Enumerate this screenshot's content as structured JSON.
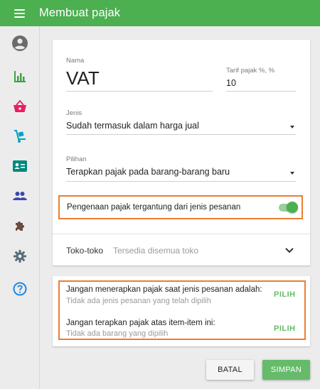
{
  "header": {
    "title": "Membuat pajak",
    "menu_icon": "hamburger-menu-icon"
  },
  "sidebar": {
    "items": [
      {
        "name": "profile",
        "icon": "account-circle-icon",
        "color": "#6b6b6b"
      },
      {
        "name": "reports",
        "icon": "bar-chart-icon",
        "color": "#43a047"
      },
      {
        "name": "items",
        "icon": "shopping-basket-icon",
        "color": "#e91e63"
      },
      {
        "name": "inventory",
        "icon": "dolly-cart-icon",
        "color": "#00a1c9"
      },
      {
        "name": "employees",
        "icon": "id-card-icon",
        "color": "#00897b"
      },
      {
        "name": "customers",
        "icon": "people-icon",
        "color": "#3949ab"
      },
      {
        "name": "integrations",
        "icon": "puzzle-icon",
        "color": "#6d4c41"
      },
      {
        "name": "settings",
        "icon": "gear-icon",
        "color": "#546e7a"
      },
      {
        "name": "help",
        "icon": "help-circle-icon",
        "color": "#1e88e5"
      }
    ]
  },
  "form": {
    "name": {
      "label": "Nama",
      "value": "VAT"
    },
    "rate": {
      "label": "Tarif pajak %, %",
      "value": "10"
    },
    "type": {
      "label": "Jenis",
      "value": "Sudah termasuk dalam harga jual"
    },
    "option": {
      "label": "Pilihan",
      "value": "Terapkan pajak pada barang-barang baru"
    },
    "toggle": {
      "label": "Pengenaan pajak tergantung dari jenis pesanan",
      "on": true
    },
    "stores": {
      "label": "Toko-toko",
      "value": "Tersedia disemua toko"
    }
  },
  "exceptions": [
    {
      "title": "Jangan menerapkan pajak saat jenis pesanan adalah:",
      "subtitle": "Tidak ada jenis pesanan yang telah dipilih",
      "action": "PILIH"
    },
    {
      "title": "Jangan terapkan pajak atas item-item ini:",
      "subtitle": "Tidak ada barang yang dipilih",
      "action": "PILIH"
    }
  ],
  "footer": {
    "cancel_label": "BATAL",
    "save_label": "SIMPAN"
  },
  "colors": {
    "primary": "#4caf50",
    "accent": "#66bb6a",
    "highlight": "#ed7d31"
  }
}
